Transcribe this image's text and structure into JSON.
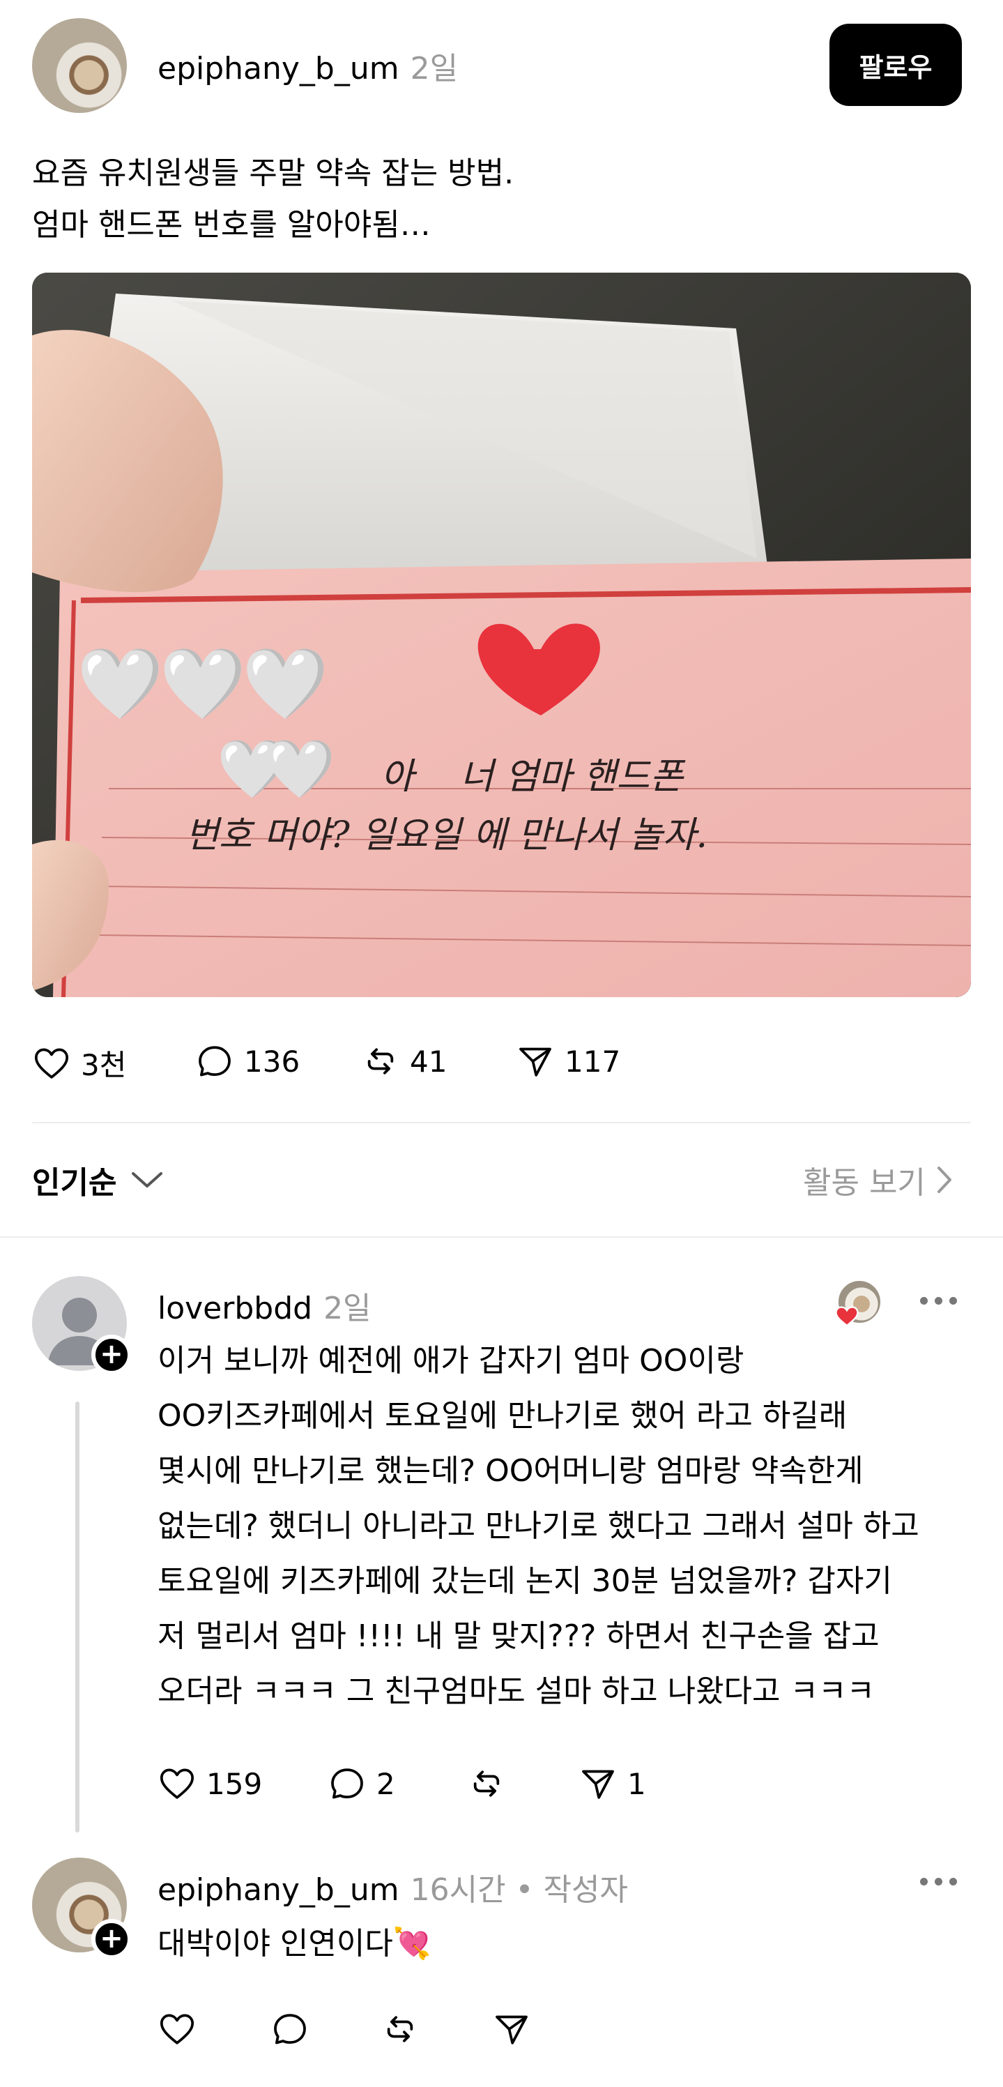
{
  "post": {
    "username": "epiphany_b_um",
    "time": "2일",
    "follow_label": "팔로우",
    "text": "요즘 유치원생들 주말 약속 잡는 방법.\n엄마 핸드폰 번호를 알아야됨…",
    "photo": {
      "note_line1": "아    너 엄마 핸드폰",
      "note_line2": "번호 머야? 일요일 에 만나서 놀자.",
      "heart_emojis": "🤍🤍🤍",
      "heart_emojis2": "🤍🤍"
    },
    "actions": {
      "likes": "3천",
      "comments": "136",
      "reposts": "41",
      "shares": "117"
    }
  },
  "sort": {
    "label": "인기순",
    "activity_label": "활동 보기"
  },
  "comments": [
    {
      "username": "loverbbdd",
      "time": "2일",
      "text": "이거 보니까 예전에 애가 갑자기 엄마 OO이랑\nOO키즈카페에서 토요일에 만나기로 했어 라고 하길래\n몇시에 만나기로 했는데? OO어머니랑 엄마랑 약속한게\n없는데? 했더니 아니라고 만나기로 했다고 그래서 설마 하고\n토요일에 키즈카페에 갔는데 논지 30분 넘었을까? 갑자기\n저 멀리서 엄마 !!!! 내 말 맞지??? 하면서 친구손을 잡고\n오더라 ㅋㅋㅋ 그 친구엄마도 설마 하고 나왔다고 ㅋㅋㅋ",
      "likes": "159",
      "replies": "2",
      "reposts": "",
      "shares": "1"
    },
    {
      "username": "epiphany_b_um",
      "time": "16시간 • 작성자",
      "text": "대박이야 인연이다💘"
    }
  ],
  "colors": {
    "accent": "#000000",
    "muted": "#9a9a9a",
    "divider": "#ececec",
    "heart": "#e8323c"
  }
}
